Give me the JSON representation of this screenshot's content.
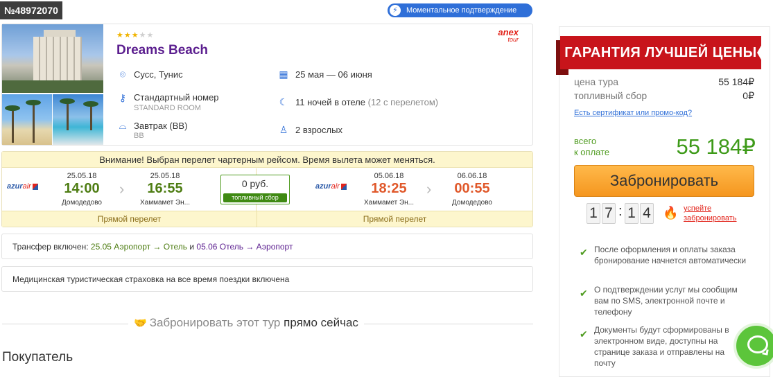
{
  "order": {
    "number": "№48972070"
  },
  "badge": {
    "instant_label": "Моментальное подтверждение"
  },
  "hotel": {
    "stars_on": "★★★",
    "stars_off": "★★",
    "name": "Dreams Beach",
    "operator_line1": "anex",
    "operator_line2": "tour",
    "location": "Сусс, Тунис",
    "dates": "25 мая — 06 июня",
    "room": "Стандартный номер",
    "room_sub": "STANDARD ROOM",
    "nights": "11 ночей в отеле",
    "nights_extra": "(12 с перелетом)",
    "meal": "Завтрак (BB)",
    "meal_sub": "BB",
    "guests": "2 взрослых"
  },
  "flight": {
    "warning": "Внимание! Выбран перелет чартерным рейсом. Время вылета может меняться.",
    "airline": "azur",
    "airline_suffix": "air",
    "outbound": {
      "dep_date": "25.05.18",
      "dep_time": "14:00",
      "dep_place": "Домодедово",
      "arr_date": "25.05.18",
      "arr_time": "16:55",
      "arr_place": "Хаммамет Эн..."
    },
    "inbound": {
      "dep_date": "05.06.18",
      "dep_time": "18:25",
      "dep_place": "Хаммамет Эн...",
      "arr_date": "06.06.18",
      "arr_time": "00:55",
      "arr_place": "Домодедово"
    },
    "fuel_value": "0 руб.",
    "fuel_label": "топливный сбор",
    "direct_out": "Прямой перелет",
    "direct_in": "Прямой перелет"
  },
  "transfer": {
    "prefix": "Трансфер включен:",
    "out": "25.05 Аэропорт → Отель",
    "and": "и",
    "back": "05.06 Отель → Аэропорт"
  },
  "insurance": {
    "text": "Медицинская туристическая страховка на все время поездки включена"
  },
  "book_section": {
    "title_light": "Забронировать этот тур",
    "title_dark": "прямо сейчас"
  },
  "buyer": {
    "title": "Покупатель"
  },
  "sidebar": {
    "guarantee": "ГАРАНТИЯ ЛУЧШЕЙ ЦЕНЫ",
    "tour_price_label": "цена тура",
    "tour_price": "55 184₽",
    "fuel_label": "топливный сбор",
    "fuel_price": "0₽",
    "promo_link": "Есть сертификат или промо-код?",
    "total_label_1": "всего",
    "total_label_2": "к оплате",
    "total": "55 184₽",
    "book_button": "Забронировать",
    "timer_min_1": "1",
    "timer_min_2": "7",
    "timer_sep": ":",
    "timer_sec_1": "1",
    "timer_sec_2": "4",
    "hurry_1": "успейте",
    "hurry_2": "забронировать",
    "notes": [
      "После оформления и оплаты заказа бронирование начнется автоматически",
      "О подтверждении услуг мы сообщим вам по SMS, электронной почте и телефону",
      "Документы будут сформированы в электронном виде, доступны на странице заказа и отправлены на почту"
    ]
  },
  "colors": {
    "purple": "#5b1e8f",
    "green": "#3d9a18",
    "orange": "#f5961f",
    "red": "#c8141b",
    "blue": "#2f6fd8"
  }
}
